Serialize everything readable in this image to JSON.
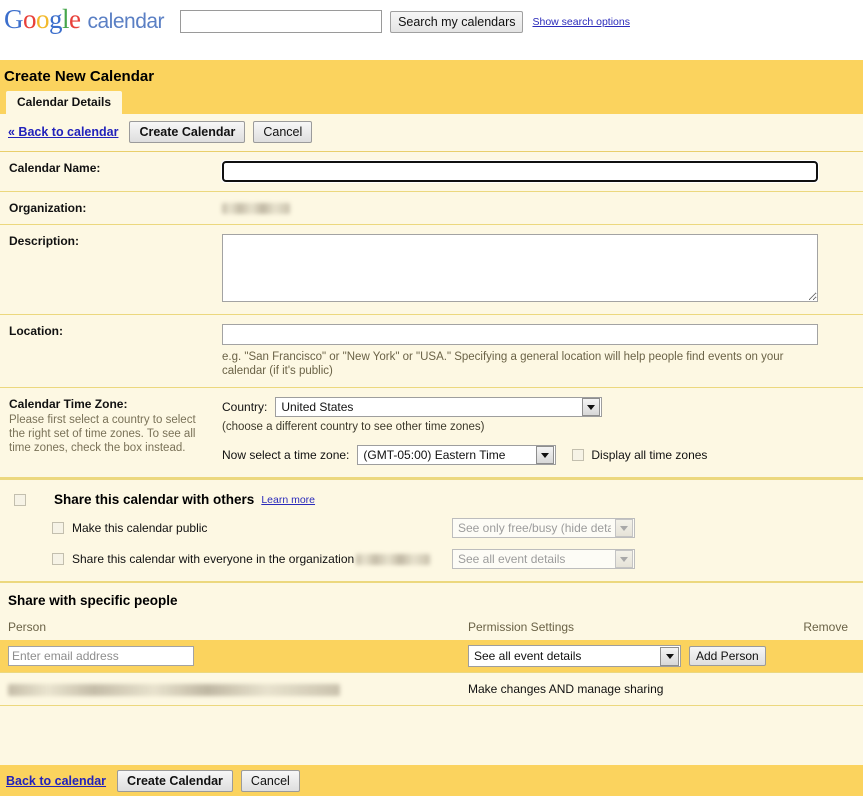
{
  "topbar": {
    "logo_google": [
      "G",
      "o",
      "o",
      "g",
      "l",
      "e"
    ],
    "logo_product": "calendar",
    "search_value": "",
    "search_placeholder": "",
    "search_button": "Search my calendars",
    "search_options_link": "Show search options"
  },
  "header": {
    "page_title": "Create New Calendar",
    "tab_label": "Calendar Details"
  },
  "actionbar": {
    "back_link": "« Back to calendar",
    "create_button": "Create Calendar",
    "cancel_button": "Cancel"
  },
  "form": {
    "calendar_name_label": "Calendar Name:",
    "calendar_name_value": "",
    "organization_label": "Organization:",
    "organization_value": "",
    "description_label": "Description:",
    "description_value": "",
    "location_label": "Location:",
    "location_value": "",
    "location_hint": "e.g. \"San Francisco\" or \"New York\" or \"USA.\" Specifying a general location will help people find events on your calendar (if it's public)"
  },
  "timezone": {
    "section_label": "Calendar Time Zone:",
    "section_help": "Please first select a country to select the right set of time zones. To see all time zones, check the box instead.",
    "country_label": "Country:",
    "country_value": "United States",
    "country_note": "(choose a different country to see other time zones)",
    "zone_label": "Now select a time zone:",
    "zone_value": "(GMT-05:00) Eastern Time",
    "display_all_label": "Display all time zones",
    "display_all_checked": false
  },
  "share": {
    "title": "Share this calendar with others",
    "learn_more": "Learn more",
    "master_checked": false,
    "options": [
      {
        "label": "Make this calendar public",
        "checked": false,
        "permission": "See only free/busy (hide details)",
        "disabled": true
      },
      {
        "label": "Share this calendar with everyone in the organization",
        "org_name_redacted": "",
        "checked": false,
        "permission": "See all event details",
        "disabled": true
      }
    ]
  },
  "specific_people": {
    "title": "Share with specific people",
    "columns": {
      "person": "Person",
      "permission": "Permission Settings",
      "remove": "Remove"
    },
    "add_row": {
      "email_value": "",
      "email_placeholder": "Enter email address",
      "permission_value": "See all event details",
      "add_button": "Add Person"
    },
    "existing": [
      {
        "person_redacted": "",
        "permission": "Make changes AND manage sharing"
      }
    ]
  },
  "footer": {
    "back_link": "Back to calendar",
    "create_button": "Create Calendar",
    "cancel_button": "Cancel"
  },
  "colors": {
    "gold": "#fbd35e",
    "cream": "#fdf8e3",
    "divider": "#ecd87e",
    "link": "#2222bb"
  }
}
